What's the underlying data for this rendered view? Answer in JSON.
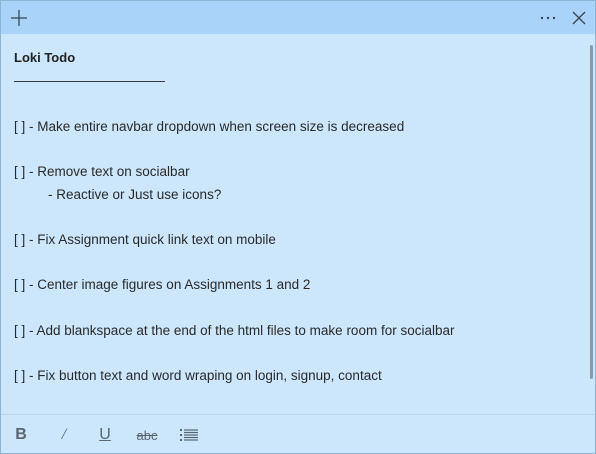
{
  "note": {
    "title": "Loki Todo",
    "lines": [
      "[ ] - Make entire navbar dropdown when screen size is decreased",
      "[ ] - Remove text on socialbar",
      "- Reactive or Just use icons?",
      "[ ] - Fix Assignment quick link text on mobile",
      "[ ] - Center image figures on Assignments 1 and 2",
      "[ ] - Add blankspace at the end of the html files to make room for socialbar",
      "[ ] - Fix button text and word wraping on login, signup, contact"
    ]
  },
  "toolbar": {
    "bold": "B",
    "italic": "/",
    "underline": "U",
    "strike": "abc"
  },
  "icons": {
    "add": "plus-icon",
    "more": "more-horizontal-icon",
    "close": "close-icon",
    "list": "bulleted-list-icon"
  },
  "colors": {
    "body": "#cce6fb",
    "titlebar": "#a9d3f8"
  }
}
